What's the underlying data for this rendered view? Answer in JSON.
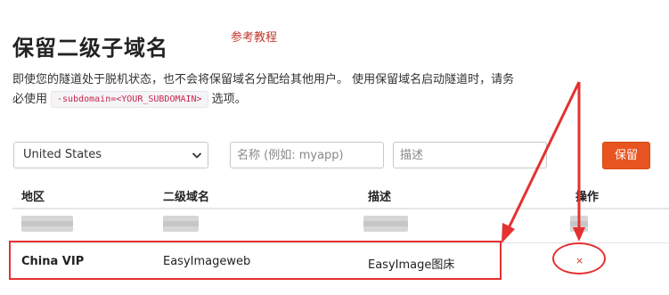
{
  "header": {
    "title": "保留二级子域名",
    "tutorial_link": "参考教程"
  },
  "description": {
    "text_before": "即使您的隧道处于脱机状态，也不会将保留域名分配给其他用户。 使用保留域名启动隧道时，请务必使用",
    "code": "-subdomain=<YOUR_SUBDOMAIN>",
    "text_after": "选项。"
  },
  "form": {
    "region_selected": "United States",
    "name_placeholder": "名称 (例如: myapp)",
    "description_placeholder": "描述",
    "reserve_label": "保留"
  },
  "table": {
    "headers": [
      "地区",
      "二级域名",
      "描述",
      "操作"
    ],
    "rows": [
      {
        "region": "China VIP",
        "subdomain": "EasyImageweb",
        "description": "EasyImage图床",
        "action": "×"
      }
    ]
  },
  "colors": {
    "accent": "#e8541f",
    "annotation": "#e53131",
    "link": "#c0392b"
  }
}
